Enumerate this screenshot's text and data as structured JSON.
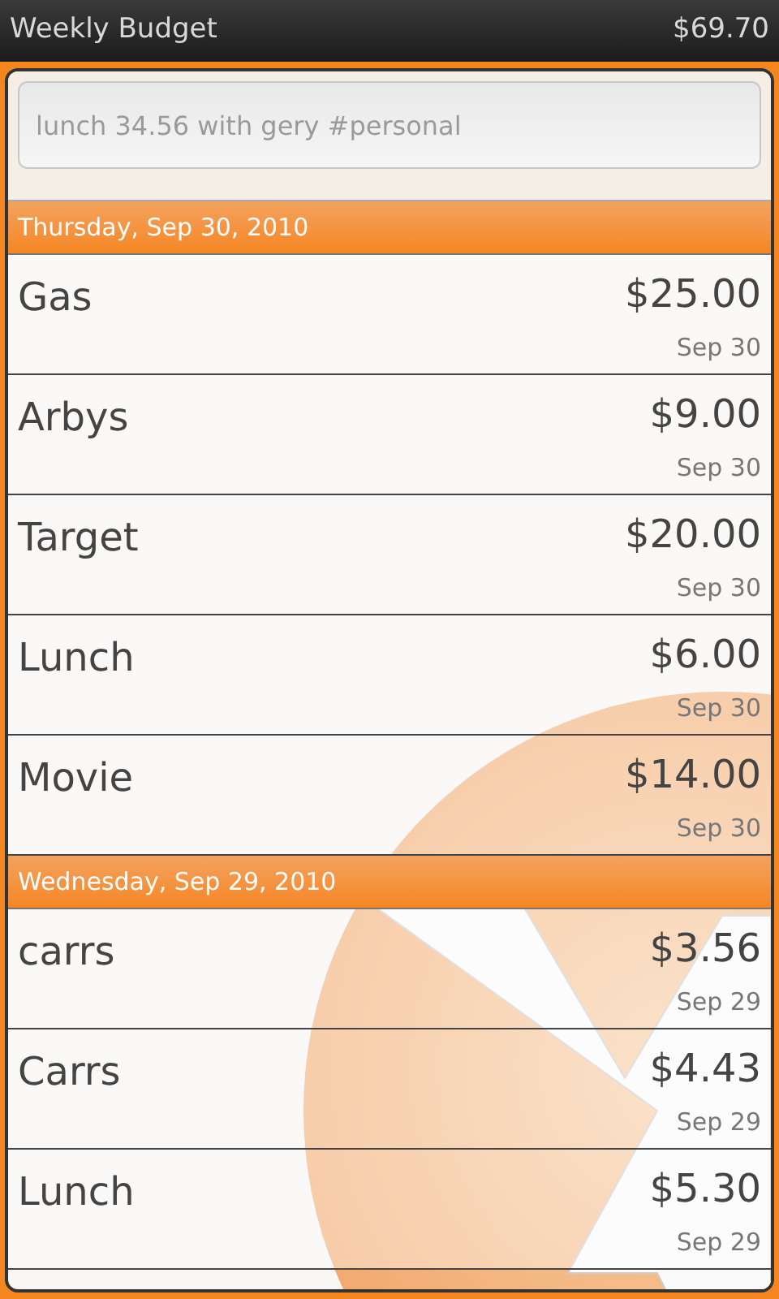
{
  "title_bar": {
    "title": "Weekly Budget",
    "total": "$69.70"
  },
  "entry": {
    "placeholder": "lunch 34.56 with gery #personal"
  },
  "groups": [
    {
      "date": "Thursday, Sep 30, 2010",
      "items": [
        {
          "name": "Gas",
          "amount": "$25.00",
          "date": "Sep 30"
        },
        {
          "name": "Arbys",
          "amount": "$9.00",
          "date": "Sep 30"
        },
        {
          "name": "Target",
          "amount": "$20.00",
          "date": "Sep 30"
        },
        {
          "name": "Lunch",
          "amount": "$6.00",
          "date": "Sep 30"
        },
        {
          "name": "Movie",
          "amount": "$14.00",
          "date": "Sep 30"
        }
      ]
    },
    {
      "date": "Wednesday, Sep 29, 2010",
      "items": [
        {
          "name": "carrs",
          "amount": "$3.56",
          "date": "Sep 29"
        },
        {
          "name": "Carrs",
          "amount": "$4.43",
          "date": "Sep 29"
        },
        {
          "name": "Lunch",
          "amount": "$5.30",
          "date": "Sep 29"
        }
      ]
    }
  ]
}
